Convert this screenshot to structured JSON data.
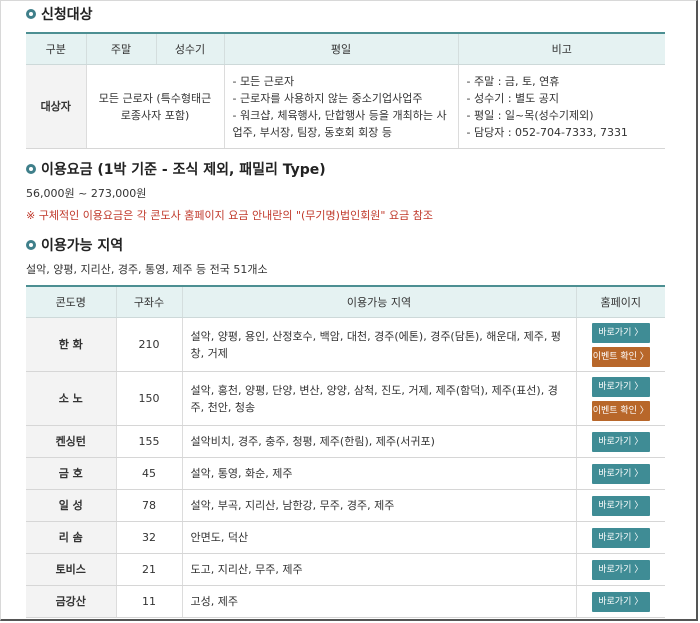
{
  "apply": {
    "title": "신청대상",
    "headers": [
      "구분",
      "주말",
      "성수기",
      "평일",
      "비고"
    ],
    "row": {
      "label": "대상자",
      "weekend": "모든 근로자 (특수형태근로종사자 포함)",
      "weekday": [
        "- 모든 근로자",
        "- 근로자를 사용하지 않는 중소기업사업주",
        "- 워크샵, 체육행사, 단합행사 등을 개최하는 사업주, 부서장, 팀장, 동호회 회장 등"
      ],
      "remarks": [
        "- 주말 : 금, 토, 연휴",
        "- 성수기 : 별도 공지",
        "- 평일 : 일~목(성수기제외)",
        "- 담당자 : 052-704-7333, 7331"
      ]
    }
  },
  "fee": {
    "title": "이용요금 (1박 기준 - 조식 제외, 패밀리 Type)",
    "range": "56,000원 ~ 273,000원",
    "notice": "※ 구체적인 이용요금은 각 콘도사 홈페이지 요금 안내란의 \"(무기명)법인회원\" 요금 참조"
  },
  "region": {
    "title": "이용가능 지역",
    "summary": "설악, 양평, 지리산, 경주, 통영, 제주 등 전국 51개소",
    "headers": [
      "콘도명",
      "구좌수",
      "이용가능 지역",
      "홈페이지"
    ],
    "buttons": {
      "go": "바로가기 〉",
      "event": "이벤트 확인 〉"
    },
    "rows": [
      {
        "name": "한 화",
        "count": "210",
        "areas": "설악, 양평, 용인, 산정호수, 백암, 대천, 경주(에톤), 경주(담톤), 해운대, 제주, 평창, 거제",
        "event": true
      },
      {
        "name": "소 노",
        "count": "150",
        "areas": "설악, 홍천, 양평, 단양, 변산, 양양, 삼척, 진도, 거제, 제주(함덕), 제주(표선), 경주, 천안, 청송",
        "event": true
      },
      {
        "name": "켄싱턴",
        "count": "155",
        "areas": "설악비치, 경주, 충주, 청평, 제주(한림), 제주(서귀포)",
        "event": false
      },
      {
        "name": "금 호",
        "count": "45",
        "areas": "설악, 통영, 화순, 제주",
        "event": false
      },
      {
        "name": "일 성",
        "count": "78",
        "areas": "설악, 부곡, 지리산, 남한강, 무주, 경주, 제주",
        "event": false
      },
      {
        "name": "리 솜",
        "count": "32",
        "areas": "안면도, 덕산",
        "event": false
      },
      {
        "name": "토비스",
        "count": "21",
        "areas": "도고, 지리산, 무주, 제주",
        "event": false
      },
      {
        "name": "금강산",
        "count": "11",
        "areas": "고성, 제주",
        "event": false
      }
    ]
  }
}
